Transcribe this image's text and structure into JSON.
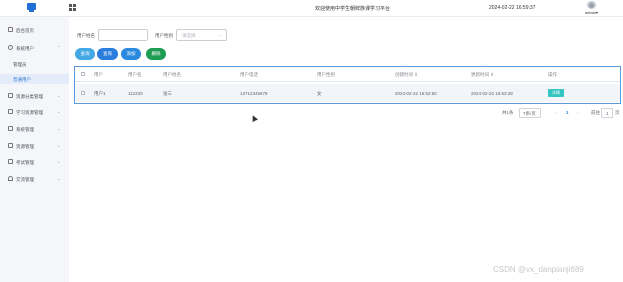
{
  "header": {
    "site_title": "欢迎使用中学生朝鲜族课学习平台",
    "datetime": "2024-02-22 16:59:37",
    "user_label": "admin▾"
  },
  "sidebar": {
    "items": [
      {
        "label": "后台首页",
        "icon": "home-icon",
        "arrow": ""
      },
      {
        "label": "系统用户",
        "icon": "user-icon",
        "arrow": "⌃"
      },
      {
        "label": "资源分类管理",
        "icon": "folder-icon",
        "arrow": "⌄"
      },
      {
        "label": "学习资源管理",
        "icon": "book-icon",
        "arrow": "⌄"
      },
      {
        "label": "系统管理",
        "icon": "system-icon",
        "arrow": "⌄"
      },
      {
        "label": "资源管理",
        "icon": "resource-icon",
        "arrow": "⌄"
      },
      {
        "label": "考试管理",
        "icon": "exam-icon",
        "arrow": "⌄"
      },
      {
        "label": "交流管理",
        "icon": "headset-icon",
        "arrow": "⌄"
      }
    ],
    "subitems": [
      {
        "label": "管理员",
        "active": false
      },
      {
        "label": "普通用户",
        "active": true
      }
    ]
  },
  "search": {
    "name_label": "用户姓名",
    "name_value": "",
    "gender_label": "用户性别",
    "gender_placeholder": "请选择"
  },
  "buttons": {
    "search": "查询",
    "query": "查询",
    "add": "添加",
    "delete": "删除"
  },
  "table": {
    "headers": [
      "用户",
      "用户名",
      "用户姓名",
      "用户电话",
      "用户性别",
      "创建时间 ⇕",
      "更新时间 ⇕",
      "操作"
    ],
    "rows": [
      {
        "type": "用户1",
        "username": "112233",
        "name": "张三",
        "phone": "13712345678",
        "gender": "女",
        "created": "2024-02-22 16:52:50",
        "updated": "2024-02-22 16:53:28",
        "action": "详情"
      }
    ]
  },
  "pagination": {
    "total": "共1条",
    "page_size": "7条/页",
    "prev": "‹",
    "page": "1",
    "next": "›",
    "goto_label": "前往",
    "goto_value": "1",
    "page_unit": "页"
  },
  "watermark": "CSDN @vx_danpianji689"
}
